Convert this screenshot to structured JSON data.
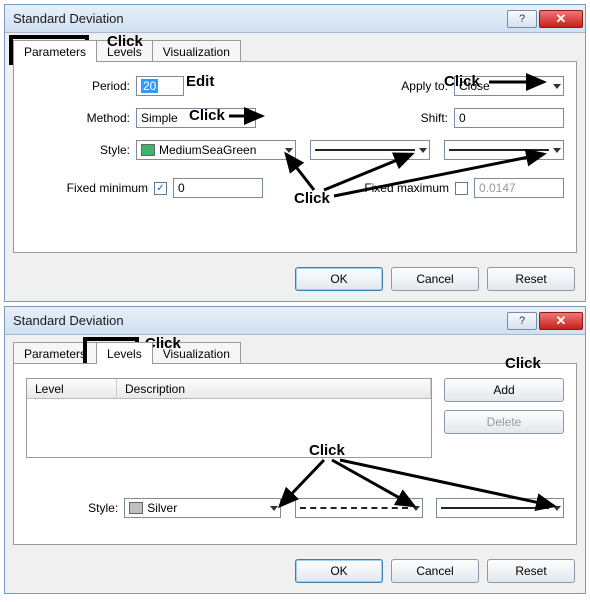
{
  "dialog1": {
    "title": "Standard Deviation",
    "tabs": {
      "parameters": "Parameters",
      "levels": "Levels",
      "visualization": "Visualization"
    },
    "period_label": "Period:",
    "period_value": "20",
    "apply_label": "Apply to:",
    "apply_value": "Close",
    "method_label": "Method:",
    "method_value": "Simple",
    "shift_label": "Shift:",
    "shift_value": "0",
    "style_label": "Style:",
    "style_color_name": "MediumSeaGreen",
    "style_color_hex": "#3cb371",
    "fixed_min_label": "Fixed minimum",
    "fixed_min_value": "0",
    "fixed_min_checked": true,
    "fixed_max_label": "Fixed maximum",
    "fixed_max_value": "0.0147",
    "fixed_max_checked": false,
    "buttons": {
      "ok": "OK",
      "cancel": "Cancel",
      "reset": "Reset"
    },
    "annot": {
      "click": "Click",
      "edit": "Edit"
    }
  },
  "dialog2": {
    "title": "Standard Deviation",
    "tabs": {
      "parameters": "Parameters",
      "levels": "Levels",
      "visualization": "Visualization"
    },
    "list": {
      "col_level": "Level",
      "col_desc": "Description"
    },
    "side": {
      "add": "Add",
      "delete": "Delete"
    },
    "style_label": "Style:",
    "style_color_name": "Silver",
    "style_color_hex": "#c0c0c0",
    "buttons": {
      "ok": "OK",
      "cancel": "Cancel",
      "reset": "Reset"
    },
    "annot": {
      "click": "Click"
    }
  }
}
